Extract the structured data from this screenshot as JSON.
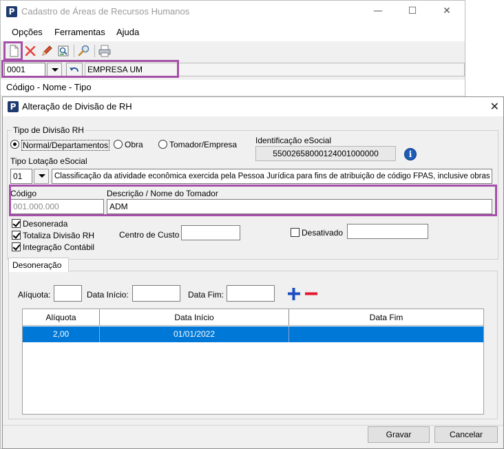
{
  "back_window": {
    "title": "Cadastro de Áreas de Recursos Humanos",
    "menu": [
      "Opções",
      "Ferramentas",
      "Ajuda"
    ],
    "company": {
      "code": "0001",
      "name": "EMPRESA UM"
    },
    "list_header": "Código - Nome - Tipo"
  },
  "dialog": {
    "title": "Alteração de Divisão de RH",
    "tipo_divisao": {
      "label": "Tipo de Divisão RH",
      "options": [
        "Normal/Departamentos",
        "Obra",
        "Tomador/Empresa"
      ],
      "selected": "Normal/Departamentos"
    },
    "identificacao_esocial": {
      "label": "Identificação eSocial",
      "value": "55002658000124001000000"
    },
    "tipo_lotacao": {
      "label": "Tipo Lotação eSocial",
      "code": "01",
      "description": "Classificação da atividade econômica exercida pela Pessoa Jurídica para fins de atribuição de código FPAS, inclusive obras"
    },
    "codigo": {
      "label": "Código",
      "placeholder": "001.000.000"
    },
    "descricao": {
      "label": "Descrição / Nome do Tomador",
      "value": "ADM"
    },
    "checkboxes": {
      "desonerada": {
        "label": "Desonerada",
        "checked": true
      },
      "totaliza": {
        "label": "Totaliza Divisão RH",
        "checked": true
      },
      "integracao": {
        "label": "Integração Contábil",
        "checked": true
      },
      "desativado": {
        "label": "Desativado",
        "checked": false
      }
    },
    "centro_custo": {
      "label": "Centro de Custo",
      "value": ""
    },
    "tab": "Desoneração",
    "filters": {
      "aliquota_label": "Alíquota:",
      "data_inicio_label": "Data Início:",
      "data_fim_label": "Data Fim:"
    },
    "grid": {
      "columns": [
        "Alíquota",
        "Data Início",
        "Data Fim"
      ],
      "rows": [
        {
          "aliquota": "2,00",
          "data_inicio": "01/01/2022",
          "data_fim": ""
        }
      ]
    },
    "buttons": {
      "gravar": "Gravar",
      "cancelar": "Cancelar"
    }
  },
  "colors": {
    "highlight": "#a550a8",
    "selection": "#0078d7",
    "plus": "#1d4fc1",
    "minus": "#e3182d"
  }
}
